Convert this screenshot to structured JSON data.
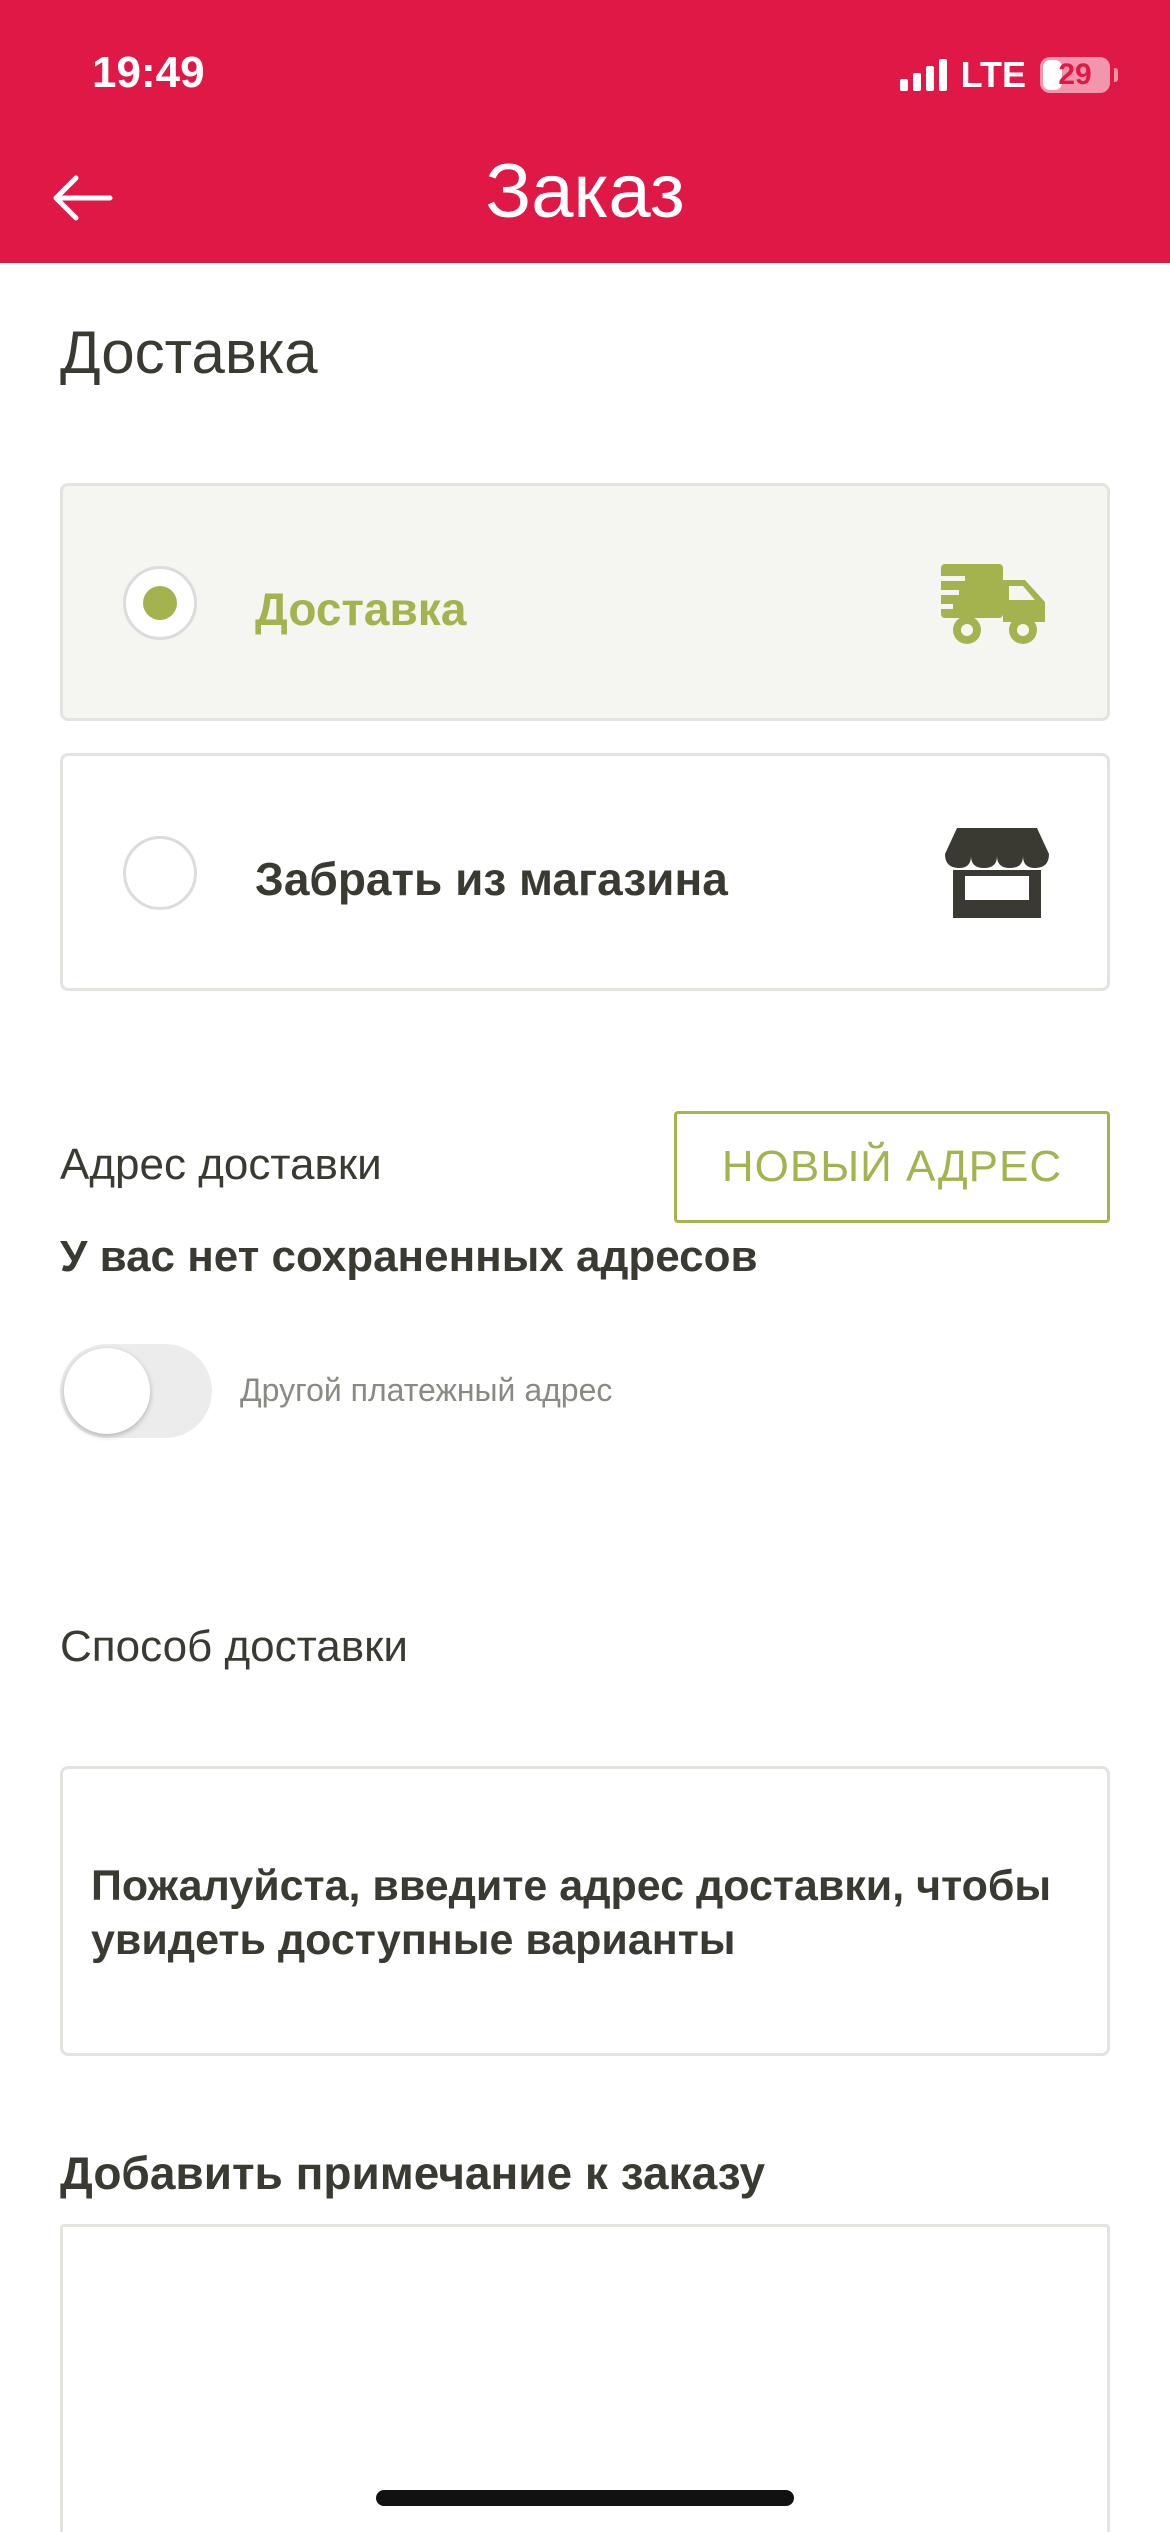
{
  "status_bar": {
    "time": "19:49",
    "network": "LTE",
    "battery": "29",
    "battery_level": 0.29
  },
  "header": {
    "title": "Заказ",
    "back_icon": "arrow-left-icon"
  },
  "delivery_section": {
    "title": "Доставка",
    "options": [
      {
        "label": "Доставка",
        "selected": true,
        "icon": "truck-icon"
      },
      {
        "label": "Забрать из магазина",
        "selected": false,
        "icon": "store-icon"
      }
    ]
  },
  "address": {
    "label": "Адрес доставки",
    "new_address_button": "НОВЫЙ АДРЕС",
    "empty_message": "У вас нет сохраненных адресов",
    "other_billing_toggle_label": "Другой платежный адрес",
    "other_billing_toggle_on": false
  },
  "shipping_method": {
    "label": "Способ доставки",
    "message": "Пожалуйста, введите адрес доставки, чтобы увидеть доступные варианты"
  },
  "order_note": {
    "label": "Добавить примечание к заказу",
    "value": ""
  },
  "colors": {
    "brand": "#e01845",
    "accent": "#a4b34e",
    "text": "#3a3a33"
  }
}
